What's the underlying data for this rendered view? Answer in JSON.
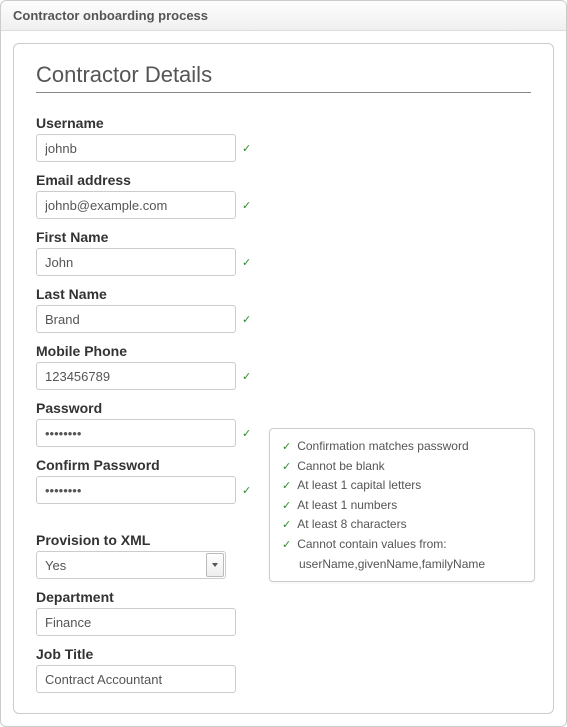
{
  "panel": {
    "title": "Contractor onboarding process"
  },
  "section": {
    "title": "Contractor Details"
  },
  "fields": {
    "username": {
      "label": "Username",
      "value": "johnb"
    },
    "email": {
      "label": "Email address",
      "value": "johnb@example.com"
    },
    "first_name": {
      "label": "First Name",
      "value": "John"
    },
    "last_name": {
      "label": "Last Name",
      "value": "Brand"
    },
    "mobile": {
      "label": "Mobile Phone",
      "value": "123456789"
    },
    "password": {
      "label": "Password",
      "value": "••••••••"
    },
    "confirm": {
      "label": "Confirm Password",
      "value": "••••••••"
    },
    "provision": {
      "label": "Provision to XML",
      "value": "Yes"
    },
    "department": {
      "label": "Department",
      "value": "Finance"
    },
    "job_title": {
      "label": "Job Title",
      "value": "Contract Accountant"
    }
  },
  "password_rules": {
    "r1": "Confirmation matches password",
    "r2": "Cannot be blank",
    "r3": "At least 1 capital letters",
    "r4": "At least 1 numbers",
    "r5": "At least 8 characters",
    "r6": "Cannot contain values from:",
    "r6_sub": "userName,givenName,familyName"
  }
}
